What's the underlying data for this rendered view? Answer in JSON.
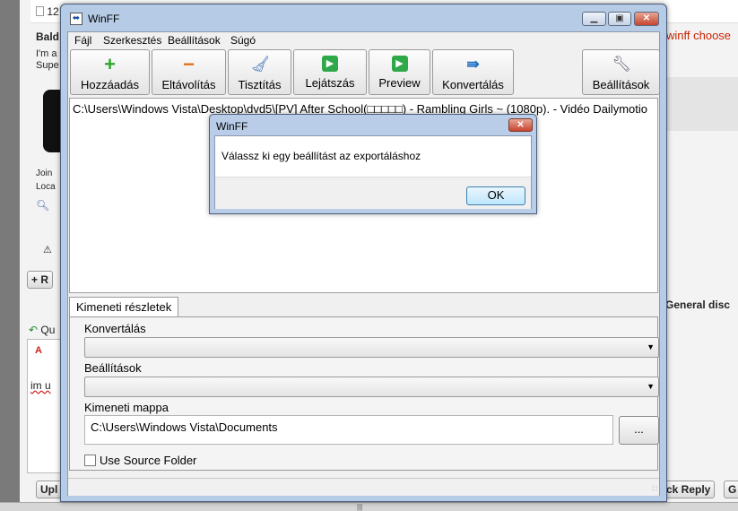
{
  "background": {
    "post_header": "12",
    "username": "Bald",
    "post_text": [
      "I'm a",
      "Supe"
    ],
    "join_label": "Join",
    "location_label": "Loca",
    "right_header_text": "winff choose",
    "right_section_text": "General disc",
    "add_button_label": "+ R",
    "quote_label": "Qu",
    "editor_text": "im u",
    "upload_button_label": "Upl",
    "quick_reply_button_label": "ck Reply",
    "g_button_label": "G",
    "accent_color": "#cc2200"
  },
  "winff": {
    "title": "WinFF",
    "menu": [
      "Fájl",
      "Szerkesztés",
      "Beállítások",
      "Súgó"
    ],
    "toolbar": {
      "add": "Hozzáadás",
      "remove": "Eltávolítás",
      "clear": "Tisztítás",
      "play": "Lejátszás",
      "preview": "Preview",
      "convert": "Konvertálás",
      "settings": "Beállítások"
    },
    "file_list": [
      "C:\\Users\\Windows Vista\\Desktop\\dvd5\\[PV] After School(□□□□□) - Rambling Girls ~ (1080p). - Vidéo Dailymotio"
    ],
    "output_tab": "Kimeneti részletek",
    "convert_label": "Konvertálás",
    "convert_value": "",
    "preset_label": "Beállítások",
    "preset_value": "",
    "output_folder_label": "Kimeneti mappa",
    "output_folder_value": "C:\\Users\\Windows Vista\\Documents",
    "browse_label": "...",
    "use_source_label": "Use Source Folder",
    "use_source_checked": false
  },
  "dialog": {
    "title": "WinFF",
    "message": "Válassz ki egy beállítást az exportáláshoz",
    "ok": "OK"
  }
}
